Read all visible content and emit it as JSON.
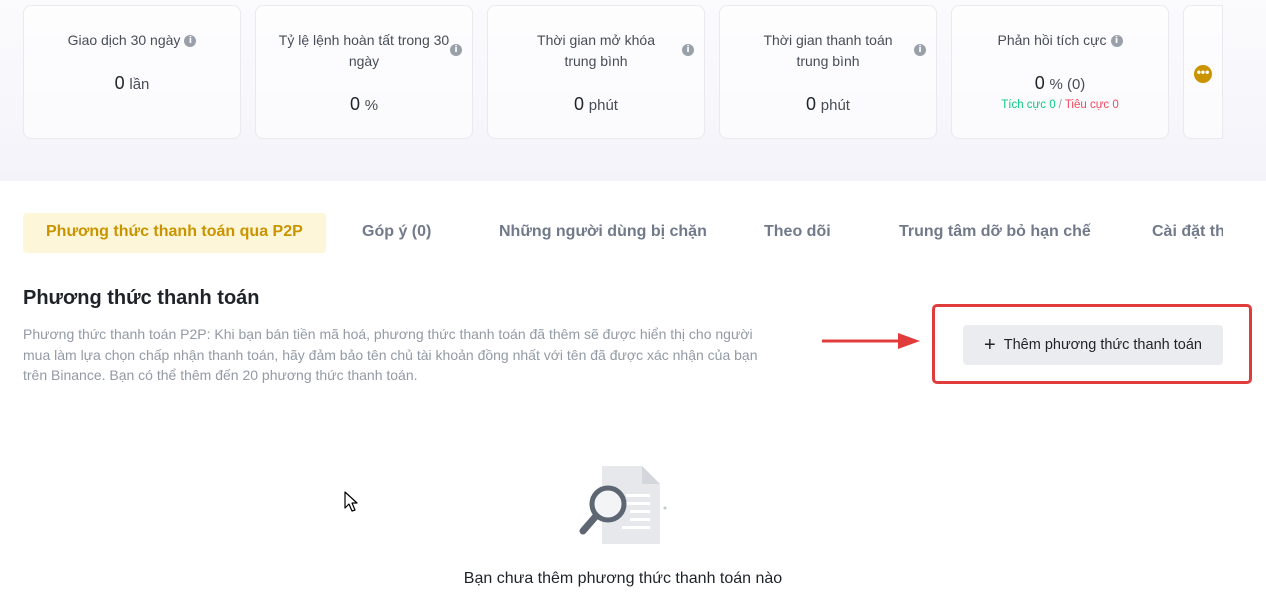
{
  "stats": [
    {
      "title": "Giao dịch 30 ngày",
      "value": "0",
      "unit": "lần"
    },
    {
      "title": "Tỷ lệ lệnh hoàn tất trong 30 ngày",
      "value": "0",
      "unit": "%"
    },
    {
      "title": "Thời gian mở khóa trung bình",
      "value": "0",
      "unit": "phút"
    },
    {
      "title": "Thời gian thanh toán trung bình",
      "value": "0",
      "unit": "phút"
    },
    {
      "title": "Phản hồi tích cực",
      "value": "0",
      "unit": "% (0)",
      "positive": "Tích cực 0",
      "separator": "/",
      "negative": "Tiêu cực 0"
    }
  ],
  "info_icon": "i",
  "more_icon": "ellipsis-icon",
  "tabs": [
    {
      "label": "Phương thức thanh toán qua P2P",
      "active": true
    },
    {
      "label": "Góp ý (0)"
    },
    {
      "label": "Những người dùng bị chặn"
    },
    {
      "label": "Theo dõi"
    },
    {
      "label": "Trung tâm dỡ bỏ hạn chế"
    },
    {
      "label": "Cài đặt thông báo"
    }
  ],
  "section": {
    "title": "Phương thức thanh toán",
    "description": "Phương thức thanh toán P2P: Khi bạn bán tiền mã hoá, phương thức thanh toán đã thêm sẽ được hiển thị cho người mua làm lựa chọn chấp nhận thanh toán, hãy đảm bảo tên chủ tài khoản đồng nhất với tên đã được xác nhận của bạn trên Binance. Bạn có thể thêm đến 20 phương thức thanh toán.",
    "add_button": "Thêm phương thức thanh toán",
    "add_icon": "+"
  },
  "empty_state": {
    "text": "Bạn chưa thêm phương thức thanh toán nào"
  },
  "colors": {
    "accent": "#c99400",
    "highlight": "#e03c3c",
    "positive": "#0ecb81",
    "negative": "#f6465d"
  }
}
